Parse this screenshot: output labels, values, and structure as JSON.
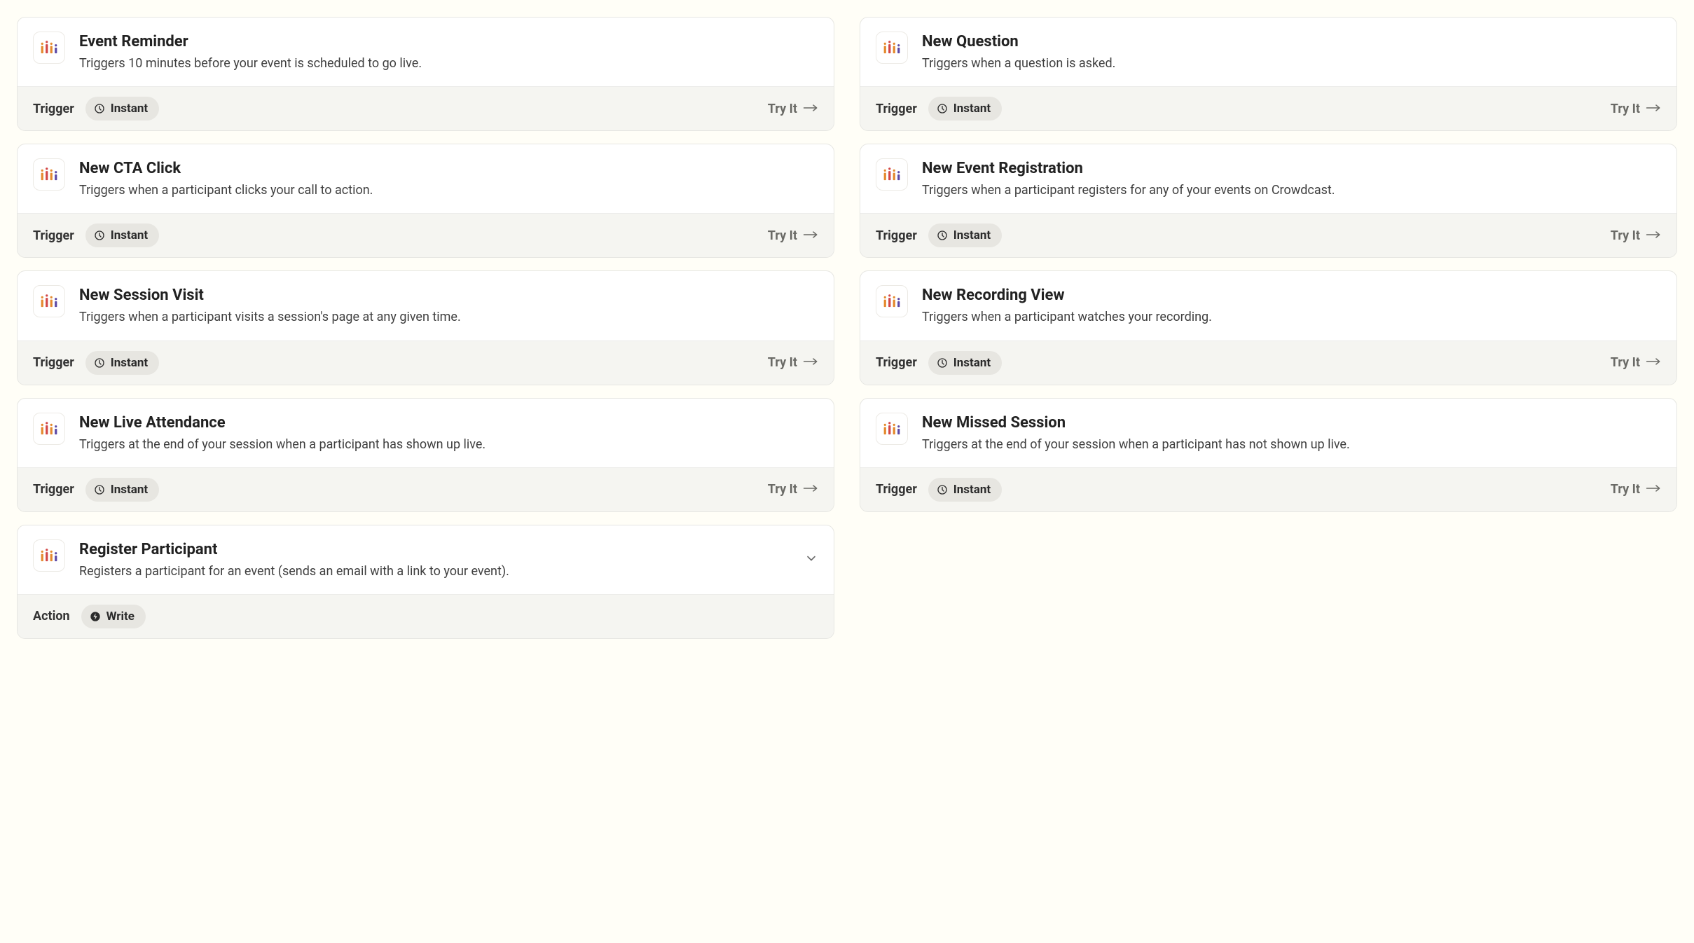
{
  "labels": {
    "trigger": "Trigger",
    "action": "Action",
    "try_it": "Try It",
    "instant": "Instant",
    "write": "Write"
  },
  "left": [
    {
      "title": "Event Reminder",
      "desc": "Triggers 10 minutes before your event is scheduled to go live.",
      "kind": "trigger",
      "pill": "instant",
      "try": true
    },
    {
      "title": "New CTA Click",
      "desc": "Triggers when a participant clicks your call to action.",
      "kind": "trigger",
      "pill": "instant",
      "try": true
    },
    {
      "title": "New Session Visit",
      "desc": "Triggers when a participant visits a session's page at any given time.",
      "kind": "trigger",
      "pill": "instant",
      "try": true
    },
    {
      "title": "New Live Attendance",
      "desc": "Triggers at the end of your session when a participant has shown up live.",
      "kind": "trigger",
      "pill": "instant",
      "try": true
    },
    {
      "title": "Register Participant",
      "desc": "Registers a participant for an event (sends an email with a link to your event).",
      "kind": "action",
      "pill": "write",
      "try": false,
      "chevron": true
    }
  ],
  "right": [
    {
      "title": "New Question",
      "desc": "Triggers when a question is asked.",
      "kind": "trigger",
      "pill": "instant",
      "try": true
    },
    {
      "title": "New Event Registration",
      "desc": "Triggers when a participant registers for any of your events on Crowdcast.",
      "kind": "trigger",
      "pill": "instant",
      "try": true
    },
    {
      "title": "New Recording View",
      "desc": "Triggers when a participant watches your recording.",
      "kind": "trigger",
      "pill": "instant",
      "try": true
    },
    {
      "title": "New Missed Session",
      "desc": "Triggers at the end of your session when a participant has not shown up live.",
      "kind": "trigger",
      "pill": "instant",
      "try": true
    }
  ]
}
